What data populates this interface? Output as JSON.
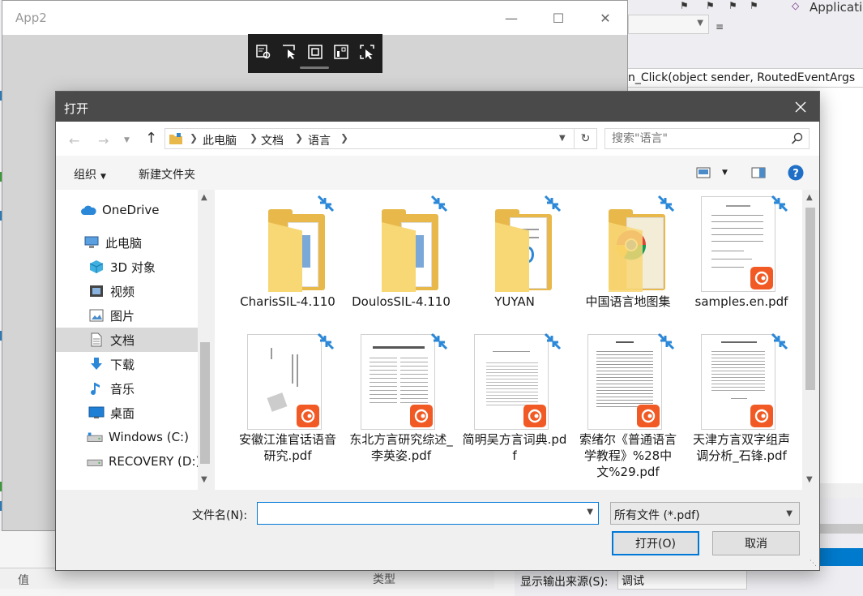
{
  "vs": {
    "toolbar_app_label": "Applicati",
    "code_line": "n_Click(object sender, RoutedEventArgs",
    "props": {
      "col_value": "值",
      "col_type": "类型"
    },
    "output": {
      "label": "显示输出来源(S):",
      "source": "调试"
    }
  },
  "app2": {
    "title": "App2",
    "minimize": "—",
    "maximize": "☐",
    "close": "✕"
  },
  "dialog": {
    "title": "打开",
    "close": "✕",
    "breadcrumb": [
      "此电脑",
      "文档",
      "语言"
    ],
    "search_placeholder": "搜索\"语言\"",
    "toolbar": {
      "organize": "组织",
      "new_folder": "新建文件夹"
    },
    "nav_items": [
      {
        "label": "OneDrive",
        "icon": "cloud-icon"
      },
      {
        "label": "此电脑",
        "icon": "computer-icon"
      },
      {
        "label": "3D 对象",
        "icon": "3d-objects-icon"
      },
      {
        "label": "视频",
        "icon": "video-icon"
      },
      {
        "label": "图片",
        "icon": "pictures-icon"
      },
      {
        "label": "文档",
        "icon": "documents-icon"
      },
      {
        "label": "下载",
        "icon": "download-icon"
      },
      {
        "label": "音乐",
        "icon": "music-icon"
      },
      {
        "label": "桌面",
        "icon": "desktop-icon"
      },
      {
        "label": "Windows (C:)",
        "icon": "drive-icon"
      },
      {
        "label": "RECOVERY (D:)",
        "icon": "drive-icon"
      }
    ],
    "files": [
      {
        "name": "CharisSIL-4.110",
        "kind": "folder"
      },
      {
        "name": "DoulosSIL-4.110",
        "kind": "folder"
      },
      {
        "name": "YUYAN",
        "kind": "folder"
      },
      {
        "name": "中国语言地图集",
        "kind": "folder"
      },
      {
        "name": "samples.en.pdf",
        "kind": "pdf"
      },
      {
        "name": "安徽江淮官话语音研究.pdf",
        "kind": "pdf"
      },
      {
        "name": "东北方言研究综述_李英姿.pdf",
        "kind": "pdf"
      },
      {
        "name": "简明吴方言词典.pdf",
        "kind": "pdf"
      },
      {
        "name": "索绪尔《普通语言学教程》%28中文%29.pdf",
        "kind": "pdf"
      },
      {
        "name": "天津方言双字组声调分析_石锋.pdf",
        "kind": "pdf"
      }
    ],
    "filename_label": "文件名(N):",
    "filename_value": "",
    "filter": "所有文件 (*.pdf)",
    "open_button": "打开(O)",
    "cancel_button": "取消"
  }
}
